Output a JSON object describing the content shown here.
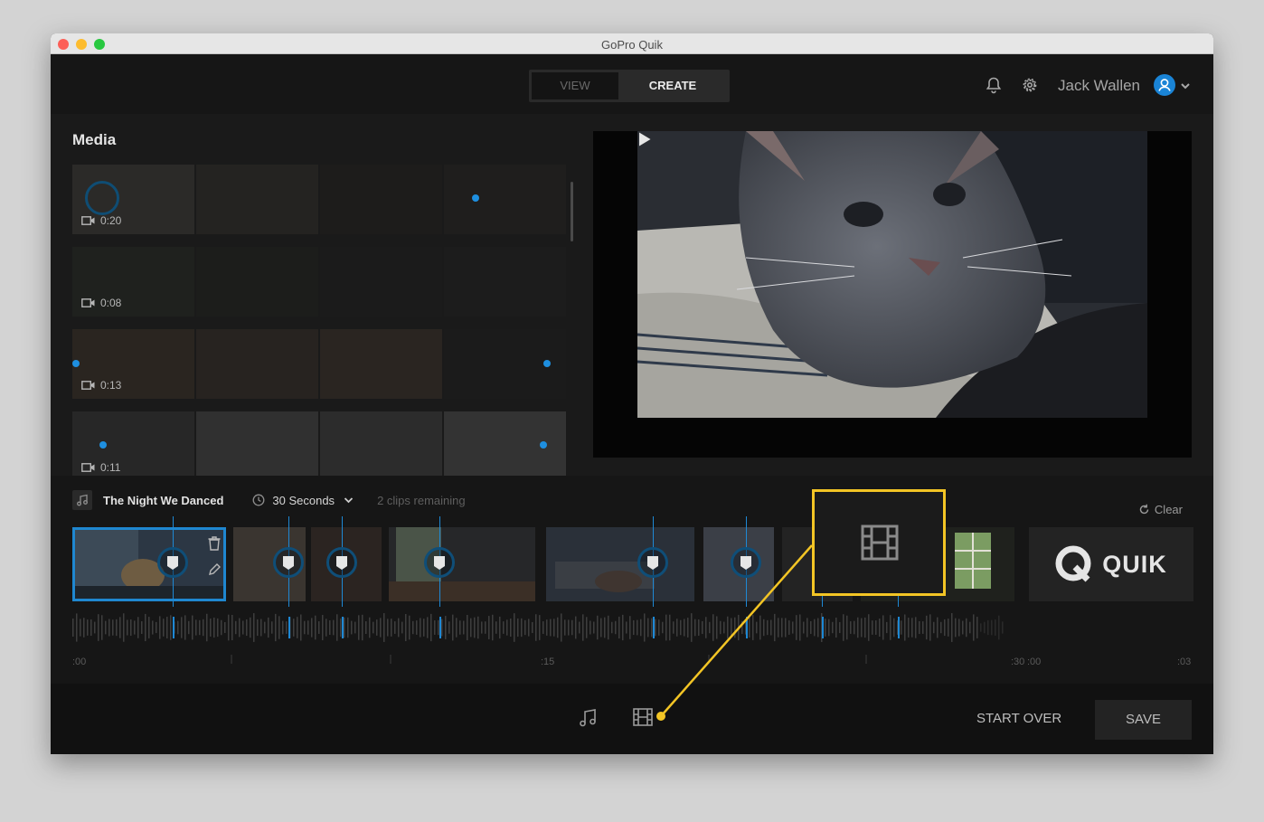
{
  "window": {
    "title": "GoPro Quik"
  },
  "nav": {
    "view_label": "VIEW",
    "create_label": "CREATE",
    "active_tab": "CREATE"
  },
  "user": {
    "name": "Jack Wallen"
  },
  "icons": {
    "bell": "bell-icon",
    "gear": "gear-icon",
    "avatar": "user-avatar-icon",
    "chevron": "chevron-down-icon",
    "camera": "video-camera-icon",
    "play": "play-icon",
    "music": "music-note-icon",
    "film": "film-strip-icon",
    "clock": "clock-icon",
    "refresh": "refresh-icon",
    "trash": "trash-icon",
    "pencil": "pencil-icon",
    "highlight": "highlight-flag-icon"
  },
  "media": {
    "title": "Media",
    "items": [
      {
        "duration": "0:20"
      },
      {
        "duration": "0:08"
      },
      {
        "duration": "0:13"
      },
      {
        "duration": "0:11"
      }
    ]
  },
  "song": {
    "title": "The Night We Danced"
  },
  "duration": {
    "selected": "30 Seconds"
  },
  "clips_remaining": "2 clips remaining",
  "clear_label": "Clear",
  "outro": {
    "brand": "QUIK"
  },
  "ruler": {
    "labels": [
      ":00",
      ":15",
      ":30",
      ":00",
      ":03"
    ]
  },
  "actions": {
    "start_over": "START OVER",
    "save": "SAVE"
  },
  "colors": {
    "accent_blue": "#1e88d4",
    "callout_yellow": "#f3c525",
    "background": "#141414"
  }
}
